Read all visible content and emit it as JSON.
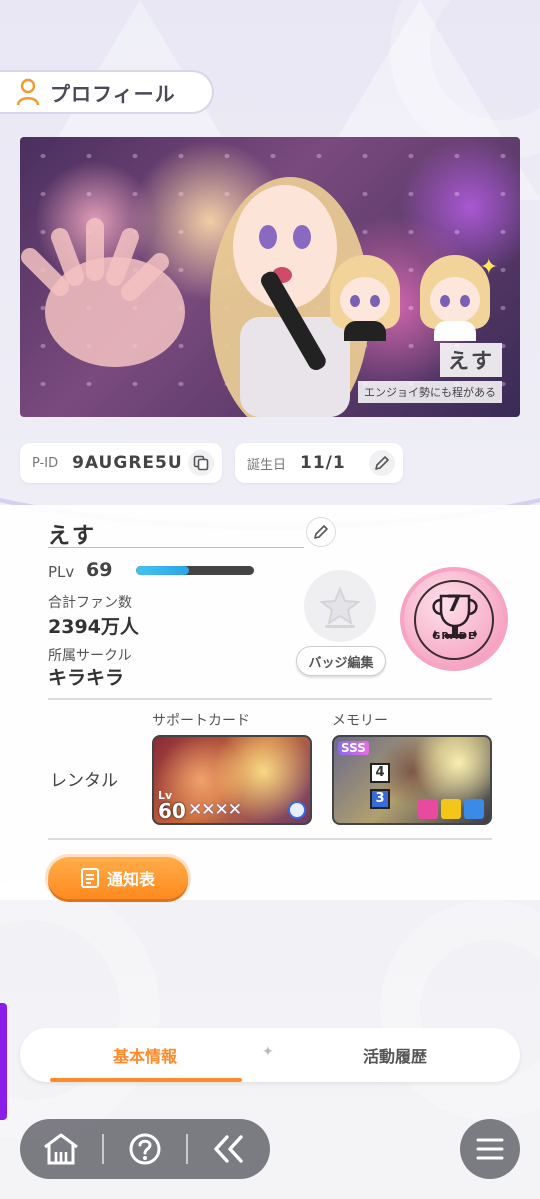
{
  "header": {
    "title": "プロフィール",
    "icon": "user-icon"
  },
  "banner": {
    "player_name": "えす",
    "title_plate": "エンジョイ勢にも程がある"
  },
  "ids": {
    "pid_label": "P-ID",
    "pid_value": "9AUGRE5U",
    "birthday_label": "誕生日",
    "birthday_value": "11/1"
  },
  "profile": {
    "name": "えす",
    "plv_label": "PLv",
    "plv_value": "69",
    "exp_fraction": 0.45,
    "fans_label": "合計ファン数",
    "fans_value": "2394万人",
    "circle_label": "所属サークル",
    "circle_value": "キラキラ",
    "badge_edit_label": "バッジ編集",
    "grade_number": "7",
    "grade_text": "GRADE"
  },
  "rental": {
    "label": "レンタル",
    "support_card_title": "サポートカード",
    "support_lv_prefix": "Lv",
    "support_lv": "60",
    "support_stars": "✕✕✕✕",
    "memory_title": "メモリー",
    "memory_rarity": "SSS",
    "memory_skill_1": "4",
    "memory_skill_2": "3"
  },
  "report_button": {
    "label": "通知表"
  },
  "tabs": {
    "basic": "基本情報",
    "history": "活動履歴",
    "active": "basic"
  },
  "nav": {
    "home": "home-icon",
    "help": "help-icon",
    "back": "back-icon",
    "menu": "menu-icon"
  },
  "colors": {
    "accent": "#ff8a2a",
    "exp_bar": "#46c2f0",
    "grade_pink": "#f6a3c4",
    "side_edge": "#8a1de8"
  }
}
